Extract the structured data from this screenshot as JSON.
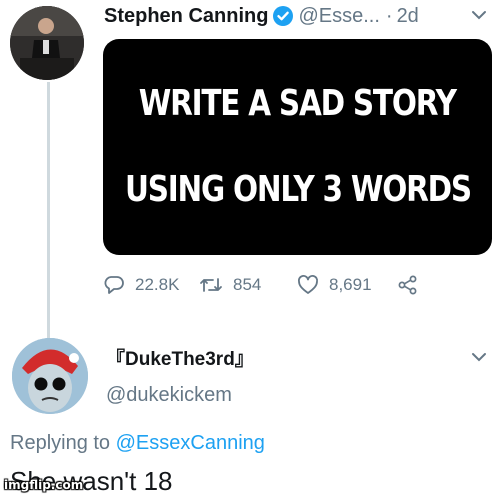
{
  "tweet": {
    "author_name": "Stephen Canning",
    "handle": "@Esse...",
    "separator": "·",
    "time": "2d",
    "media_lines": [
      "WRITE A SAD STORY",
      "USING ONLY 3 WORDS"
    ],
    "replies_count": "22.8K",
    "retweets_count": "854",
    "likes_count": "8,691"
  },
  "reply": {
    "author_name": "『DukeThe3rd』",
    "handle": "@dukekickem",
    "replying_prefix": "Replying to",
    "replying_to": "@EssexCanning",
    "text": "She wasn't 18"
  },
  "watermark": "imgflip.com",
  "colors": {
    "verified": "#1da1f2",
    "secondary_text": "#657786",
    "link": "#1da1f2",
    "media_bg": "#000000"
  },
  "icons": {
    "reply": "reply-icon",
    "retweet": "retweet-icon",
    "like": "heart-icon",
    "share": "share-icon",
    "more": "chevron-down-icon",
    "verified": "verified-badge-icon"
  }
}
